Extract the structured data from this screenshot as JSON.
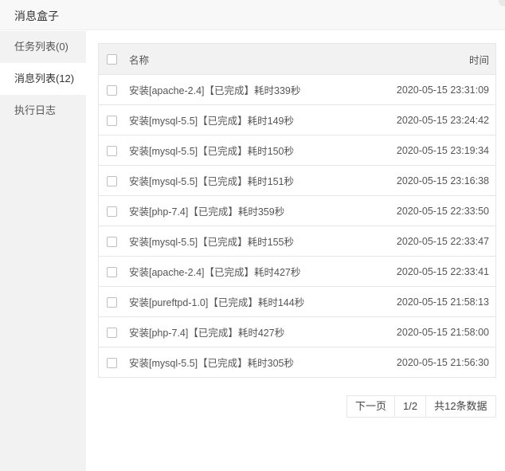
{
  "window": {
    "title": "消息盒子"
  },
  "sidebar": {
    "items": [
      {
        "label": "任务列表(0)",
        "active": false
      },
      {
        "label": "消息列表(12)",
        "active": true
      },
      {
        "label": "执行日志",
        "active": false
      }
    ]
  },
  "table": {
    "headers": {
      "name": "名称",
      "time": "时间"
    },
    "rows": [
      {
        "name": "安装[apache-2.4]【已完成】耗时339秒",
        "time": "2020-05-15 23:31:09"
      },
      {
        "name": "安装[mysql-5.5]【已完成】耗时149秒",
        "time": "2020-05-15 23:24:42"
      },
      {
        "name": "安装[mysql-5.5]【已完成】耗时150秒",
        "time": "2020-05-15 23:19:34"
      },
      {
        "name": "安装[mysql-5.5]【已完成】耗时151秒",
        "time": "2020-05-15 23:16:38"
      },
      {
        "name": "安装[php-7.4]【已完成】耗时359秒",
        "time": "2020-05-15 22:33:50"
      },
      {
        "name": "安装[mysql-5.5]【已完成】耗时155秒",
        "time": "2020-05-15 22:33:47"
      },
      {
        "name": "安装[apache-2.4]【已完成】耗时427秒",
        "time": "2020-05-15 22:33:41"
      },
      {
        "name": "安装[pureftpd-1.0]【已完成】耗时144秒",
        "time": "2020-05-15 21:58:13"
      },
      {
        "name": "安装[php-7.4]【已完成】耗时427秒",
        "time": "2020-05-15 21:58:00"
      },
      {
        "name": "安装[mysql-5.5]【已完成】耗时305秒",
        "time": "2020-05-15 21:56:30"
      }
    ]
  },
  "pagination": {
    "next_label": "下一页",
    "page_indicator": "1/2",
    "total_label": "共12条数据"
  }
}
